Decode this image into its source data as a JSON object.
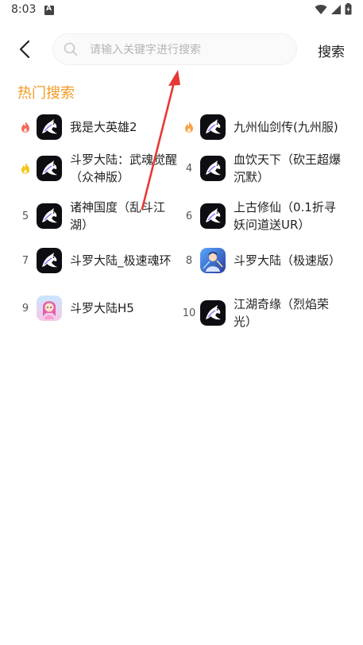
{
  "status_bar": {
    "time": "8:03",
    "icons": [
      "a-notification-icon",
      "wifi-icon",
      "signal-icon",
      "battery-icon"
    ]
  },
  "header": {
    "search_placeholder": "请输入关键字进行搜索",
    "search_value": "",
    "search_button": "搜索"
  },
  "hot_search": {
    "title": "热门搜索",
    "items": [
      {
        "rank": "",
        "rank_icon": "flame-icon",
        "title": "我是大英雄2",
        "icon": "horse-logo-icon"
      },
      {
        "rank": "",
        "rank_icon": "flame-icon",
        "title": "九州仙剑传(九州服)",
        "icon": "horse-logo-icon"
      },
      {
        "rank": "",
        "rank_icon": "flame-yellow-icon",
        "title": "斗罗大陆：武魂觉醒（众神版）",
        "icon": "horse-logo-icon"
      },
      {
        "rank": "4",
        "title": "血饮天下（砍王超爆沉默）",
        "icon": "horse-logo-icon"
      },
      {
        "rank": "5",
        "title": "诸神国度（乱斗江湖）",
        "icon": "horse-logo-icon"
      },
      {
        "rank": "6",
        "title": "上古修仙（0.1折寻妖问道送UR）",
        "icon": "horse-logo-icon"
      },
      {
        "rank": "7",
        "title": "斗罗大陆_极速魂环",
        "icon": "horse-logo-icon"
      },
      {
        "rank": "8",
        "title": "斗罗大陆（极速版）",
        "icon": "game-art-icon"
      },
      {
        "rank": "9",
        "title": "斗罗大陆H5",
        "icon": "character-art-icon"
      },
      {
        "rank": "10",
        "title": "江湖奇缘（烈焰荣光）",
        "icon": "horse-logo-icon"
      }
    ]
  },
  "colors": {
    "accent": "#f59a23",
    "annotation_arrow": "#e53935",
    "flame_red": "#f26b5b",
    "flame_yellow": "#f5c518"
  }
}
